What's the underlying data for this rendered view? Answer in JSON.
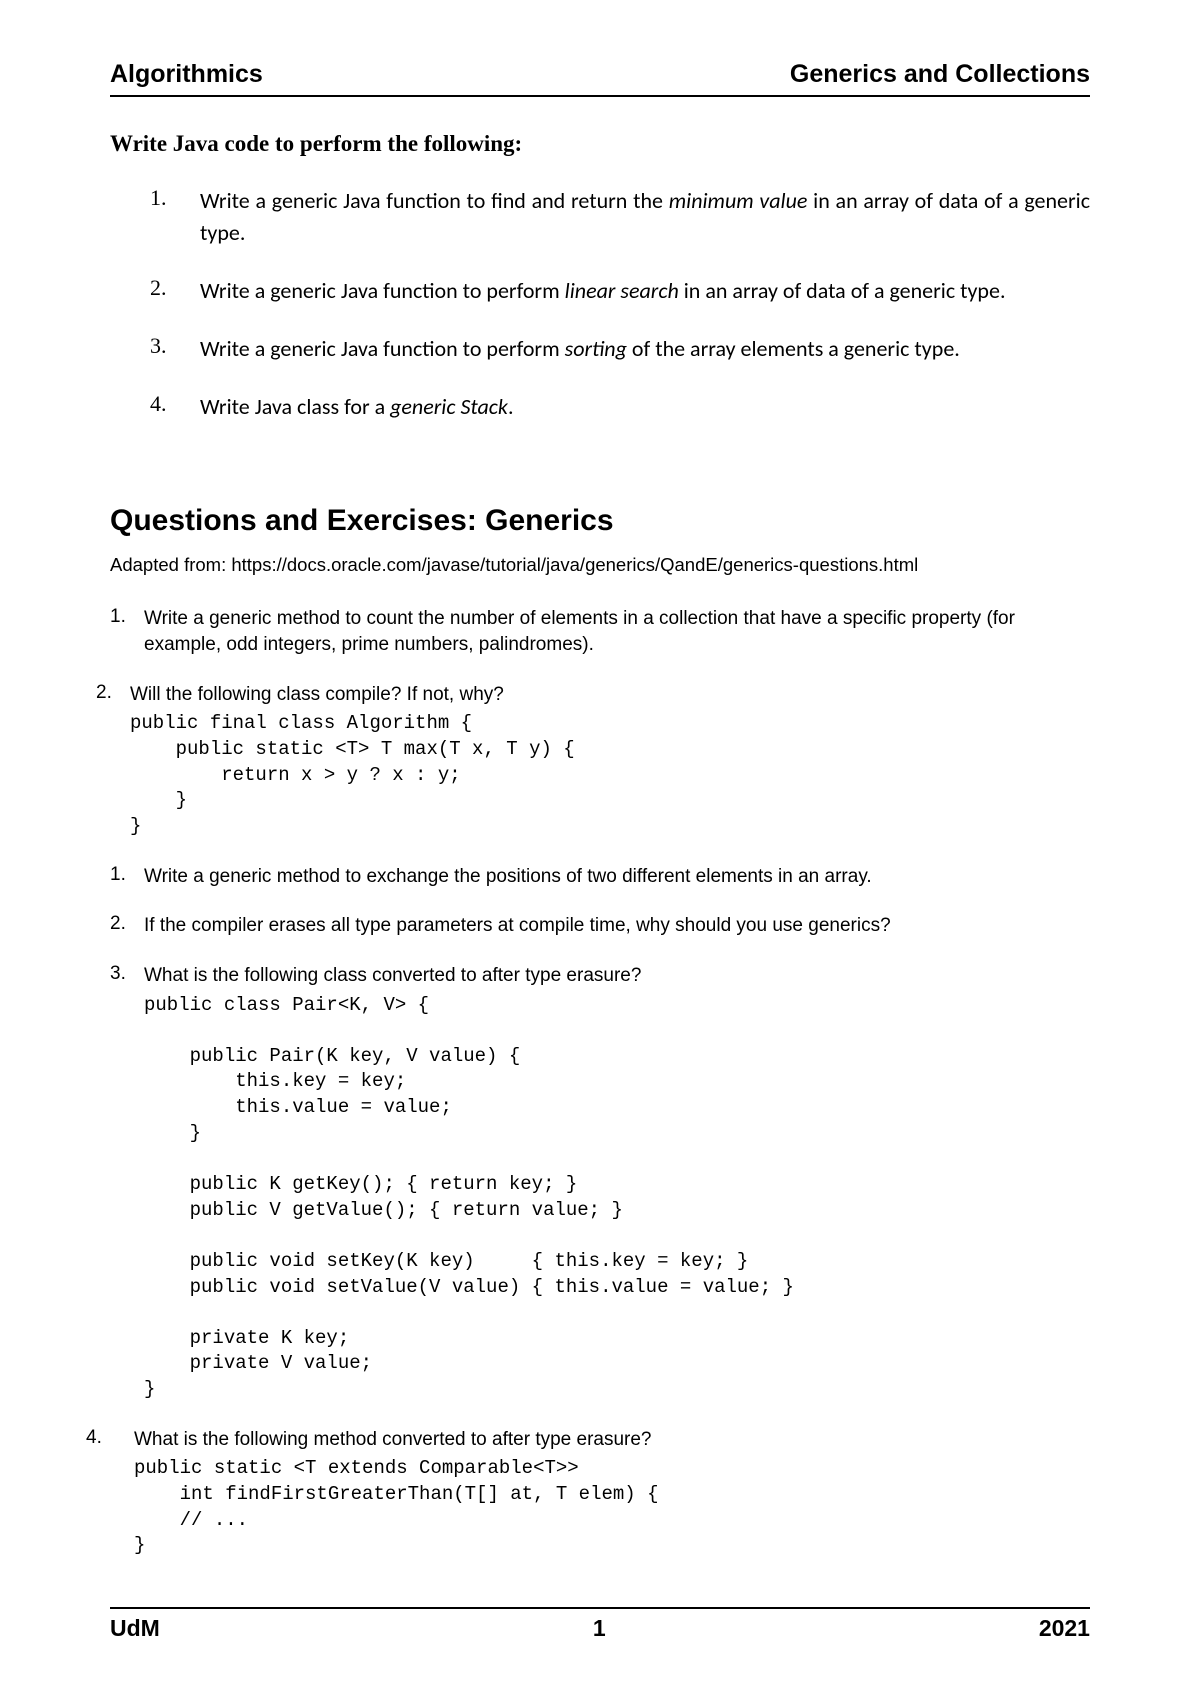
{
  "header": {
    "left": "Algorithmics",
    "right": "Generics and Collections"
  },
  "intro": "Write Java code to perform the following:",
  "tasks": [
    {
      "num": "1.",
      "pre": "Write a generic Java function to find and return the ",
      "em": "minimum value",
      "post": " in an array of data of a generic type."
    },
    {
      "num": "2.",
      "pre": "Write a generic Java function to perform ",
      "em": "linear search",
      "post": " in an array of data of a generic type."
    },
    {
      "num": "3.",
      "pre": "Write a generic Java function to perform ",
      "em": "sorting",
      "post": " of the array elements a generic type."
    },
    {
      "num": "4.",
      "pre": "Write Java class for a ",
      "em": "generic Stack",
      "post": "."
    }
  ],
  "section_title": "Questions and Exercises: Generics",
  "adapted": "Adapted from: https://docs.oracle.com/javase/tutorial/java/generics/QandE/generics-questions.html",
  "qa": {
    "q1": {
      "num": "1.",
      "text": "Write a generic method to count the number of elements in a collection that have a specific property (for example, odd integers, prime numbers, palindromes)."
    },
    "q2": {
      "num": "2.",
      "text": "Will the following class compile? If not, why?"
    },
    "code2": "public final class Algorithm {\n    public static <T> T max(T x, T y) {\n        return x > y ? x : y;\n    }\n}",
    "q3": {
      "num": "1.",
      "text": "Write a generic method to exchange the positions of two different elements in an array."
    },
    "q4": {
      "num": "2.",
      "text": "If the compiler erases all type parameters at compile time, why should you use generics?"
    },
    "q5": {
      "num": "3.",
      "text": "What is the following class converted to after type erasure?"
    },
    "code5": "public class Pair<K, V> {\n\n    public Pair(K key, V value) {\n        this.key = key;\n        this.value = value;\n    }\n\n    public K getKey(); { return key; }\n    public V getValue(); { return value; }\n\n    public void setKey(K key)     { this.key = key; }\n    public void setValue(V value) { this.value = value; }\n\n    private K key;\n    private V value;\n}",
    "q6": {
      "num": "4.",
      "text": "What is the following method converted to after type erasure?"
    },
    "code6": "public static <T extends Comparable<T>>\n    int findFirstGreaterThan(T[] at, T elem) {\n    // ...\n}"
  },
  "footer": {
    "left": "UdM",
    "center": "1",
    "right": "2021"
  }
}
